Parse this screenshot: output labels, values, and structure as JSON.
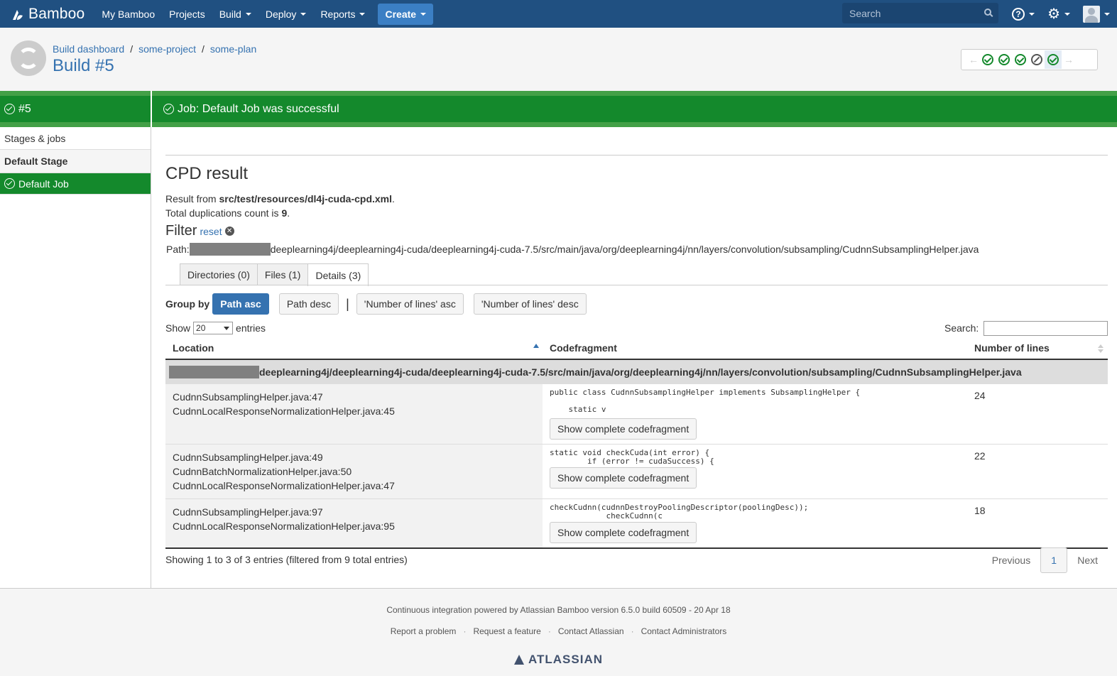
{
  "topbar": {
    "logo": "Bamboo",
    "nav": [
      "My Bamboo",
      "Projects",
      "Build",
      "Deploy",
      "Reports"
    ],
    "create": "Create",
    "search_placeholder": "Search"
  },
  "header": {
    "breadcrumb": [
      "Build dashboard",
      "some-project",
      "some-plan"
    ],
    "title": "Build #5"
  },
  "status": {
    "left": "#5",
    "right": "Job: Default Job was successful"
  },
  "sidebar": {
    "stages_jobs": "Stages & jobs",
    "stage": "Default Stage",
    "job": "Default Job"
  },
  "main": {
    "title": "CPD result",
    "result_from_prefix": "Result from ",
    "result_from_file": "src/test/resources/dl4j-cuda-cpd.xml",
    "result_from_suffix": ".",
    "total_prefix": "Total duplications count is ",
    "total_count": "9",
    "total_suffix": ".",
    "filter_label": "Filter",
    "reset_label": "reset",
    "path_label": "Path:",
    "path_value": "deeplearning4j/deeplearning4j-cuda/deeplearning4j-cuda-7.5/src/main/java/org/deeplearning4j/nn/layers/convolution/subsampling/CudnnSubsamplingHelper.java",
    "tabs": [
      "Directories (0)",
      "Files (1)",
      "Details (3)"
    ],
    "group_by_label": "Group by",
    "group_buttons": [
      "Path asc",
      "Path desc",
      "'Number of lines' asc",
      "'Number of lines' desc"
    ],
    "pipe": "|",
    "show_label": "Show",
    "show_value": "20",
    "entries_label": "entries",
    "search_label": "Search:",
    "columns": [
      "Location",
      "Codefragment",
      "Number of lines"
    ],
    "group_path": "deeplearning4j/deeplearning4j-cuda/deeplearning4j-cuda-7.5/src/main/java/org/deeplearning4j/nn/layers/convolution/subsampling/CudnnSubsamplingHelper.java",
    "rows": [
      {
        "locations": [
          "CudnnSubsamplingHelper.java:47",
          "CudnnLocalResponseNormalizationHelper.java:45"
        ],
        "code": "public class CudnnSubsamplingHelper implements SubsamplingHelper {\n\n    static v",
        "button": "Show complete codefragment",
        "lines": "24"
      },
      {
        "locations": [
          "CudnnSubsamplingHelper.java:49",
          "CudnnBatchNormalizationHelper.java:50",
          "CudnnLocalResponseNormalizationHelper.java:47"
        ],
        "code": "static void checkCuda(int error) {\n        if (error != cudaSuccess) {",
        "button": "Show complete codefragment",
        "lines": "22"
      },
      {
        "locations": [
          "CudnnSubsamplingHelper.java:97",
          "CudnnLocalResponseNormalizationHelper.java:95"
        ],
        "code": "checkCudnn(cudnnDestroyPoolingDescriptor(poolingDesc));\n            checkCudnn(c",
        "button": "Show complete codefragment",
        "lines": "18"
      }
    ],
    "info": "Showing 1 to 3 of 3 entries (filtered from 9 total entries)",
    "pagination": {
      "prev": "Previous",
      "page": "1",
      "next": "Next"
    }
  },
  "footer": {
    "powered": "Continuous integration powered by Atlassian Bamboo version 6.5.0 build 60509 - 20 Apr 18",
    "links": [
      "Report a problem",
      "Request a feature",
      "Contact Atlassian",
      "Contact Administrators"
    ],
    "brand": "ATLASSIAN"
  }
}
